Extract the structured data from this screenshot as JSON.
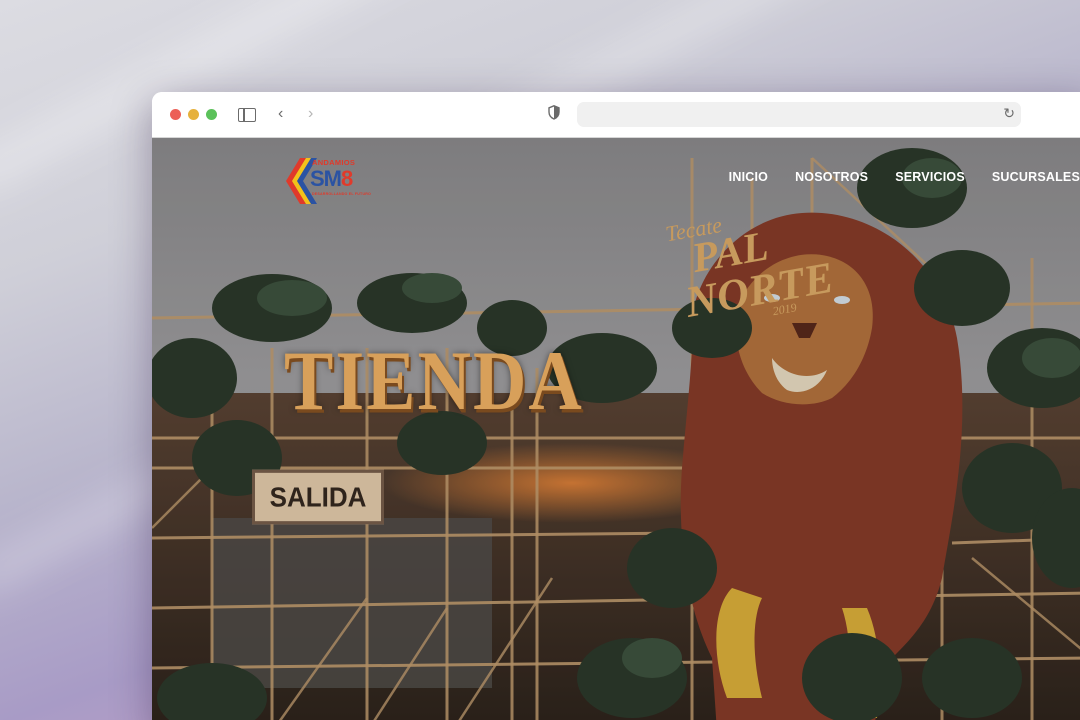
{
  "browser": {
    "window_controls": [
      "close",
      "minimize",
      "zoom"
    ],
    "toolbar_icons": [
      "sidebar-icon",
      "back-icon",
      "forward-icon",
      "shield-icon",
      "reload-icon"
    ],
    "url": ""
  },
  "site": {
    "logo": {
      "top_text": "ANDAMIOS",
      "main_text_letters": "SM",
      "main_text_digit": "8",
      "tagline": "DESARROLLANDO EL FUTURO"
    },
    "nav": {
      "items": [
        "INICIO",
        "NOSOTROS",
        "SERVICIOS",
        "SUCURSALES"
      ]
    },
    "hero": {
      "sign_tienda": "TIENDA",
      "sign_salida": "SALIDA",
      "brand_line1": "Tecate",
      "brand_line2": "PAL",
      "brand_line3": "NORTE",
      "brand_year": "2019"
    }
  },
  "colors": {
    "logo_red": "#e03a2b",
    "logo_blue": "#2b53a3",
    "logo_yellow": "#f2c21b",
    "nav_text": "#ffffff",
    "sign_gold": "#d8a05a"
  }
}
